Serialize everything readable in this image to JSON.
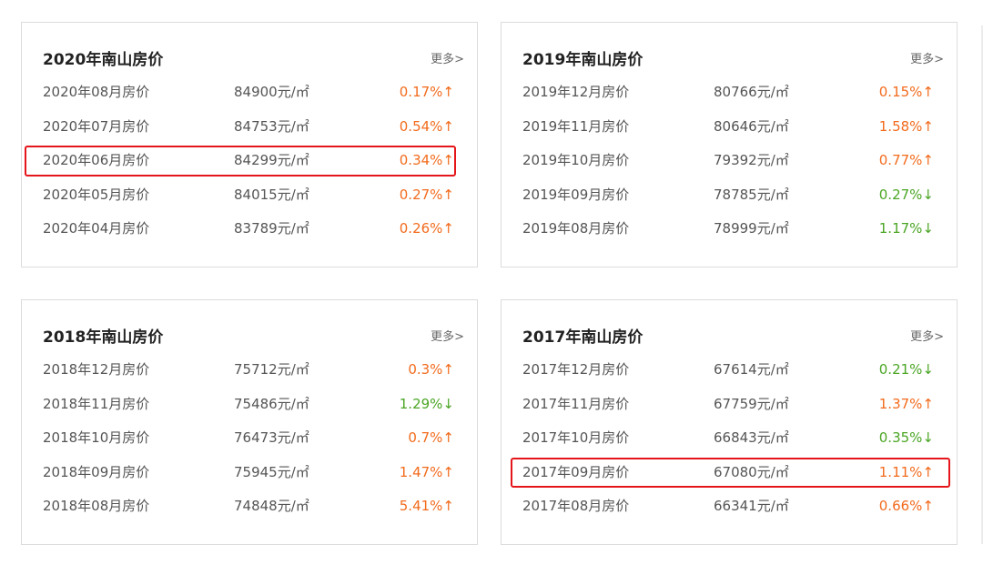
{
  "cards": [
    {
      "title": "2020年南山房价",
      "more": "更多>",
      "rows": [
        {
          "month": "2020年08月房价",
          "price": "84900元/㎡",
          "change": "0.17%↑",
          "dir": "up",
          "highlight": false
        },
        {
          "month": "2020年07月房价",
          "price": "84753元/㎡",
          "change": "0.54%↑",
          "dir": "up",
          "highlight": false
        },
        {
          "month": "2020年06月房价",
          "price": "84299元/㎡",
          "change": "0.34%↑",
          "dir": "up",
          "highlight": true
        },
        {
          "month": "2020年05月房价",
          "price": "84015元/㎡",
          "change": "0.27%↑",
          "dir": "up",
          "highlight": false
        },
        {
          "month": "2020年04月房价",
          "price": "83789元/㎡",
          "change": "0.26%↑",
          "dir": "up",
          "highlight": false
        }
      ]
    },
    {
      "title": "2019年南山房价",
      "more": "更多>",
      "rows": [
        {
          "month": "2019年12月房价",
          "price": "80766元/㎡",
          "change": "0.15%↑",
          "dir": "up",
          "highlight": false
        },
        {
          "month": "2019年11月房价",
          "price": "80646元/㎡",
          "change": "1.58%↑",
          "dir": "up",
          "highlight": false
        },
        {
          "month": "2019年10月房价",
          "price": "79392元/㎡",
          "change": "0.77%↑",
          "dir": "up",
          "highlight": false
        },
        {
          "month": "2019年09月房价",
          "price": "78785元/㎡",
          "change": "0.27%↓",
          "dir": "down",
          "highlight": false
        },
        {
          "month": "2019年08月房价",
          "price": "78999元/㎡",
          "change": "1.17%↓",
          "dir": "down",
          "highlight": false
        }
      ]
    },
    {
      "title": "2018年南山房价",
      "more": "更多>",
      "rows": [
        {
          "month": "2018年12月房价",
          "price": "75712元/㎡",
          "change": "0.3%↑",
          "dir": "up",
          "highlight": false
        },
        {
          "month": "2018年11月房价",
          "price": "75486元/㎡",
          "change": "1.29%↓",
          "dir": "down",
          "highlight": false
        },
        {
          "month": "2018年10月房价",
          "price": "76473元/㎡",
          "change": "0.7%↑",
          "dir": "up",
          "highlight": false
        },
        {
          "month": "2018年09月房价",
          "price": "75945元/㎡",
          "change": "1.47%↑",
          "dir": "up",
          "highlight": false
        },
        {
          "month": "2018年08月房价",
          "price": "74848元/㎡",
          "change": "5.41%↑",
          "dir": "up",
          "highlight": false
        }
      ]
    },
    {
      "title": "2017年南山房价",
      "more": "更多>",
      "rows": [
        {
          "month": "2017年12月房价",
          "price": "67614元/㎡",
          "change": "0.21%↓",
          "dir": "down",
          "highlight": false
        },
        {
          "month": "2017年11月房价",
          "price": "67759元/㎡",
          "change": "1.37%↑",
          "dir": "up",
          "highlight": false
        },
        {
          "month": "2017年10月房价",
          "price": "66843元/㎡",
          "change": "0.35%↓",
          "dir": "down",
          "highlight": false
        },
        {
          "month": "2017年09月房价",
          "price": "67080元/㎡",
          "change": "1.11%↑",
          "dir": "up",
          "highlight": true
        },
        {
          "month": "2017年08月房价",
          "price": "66341元/㎡",
          "change": "0.66%↑",
          "dir": "up",
          "highlight": false
        }
      ]
    }
  ],
  "colors": {
    "up": "#f26b1d",
    "down": "#4aa524",
    "highlight": "#e5161b"
  }
}
